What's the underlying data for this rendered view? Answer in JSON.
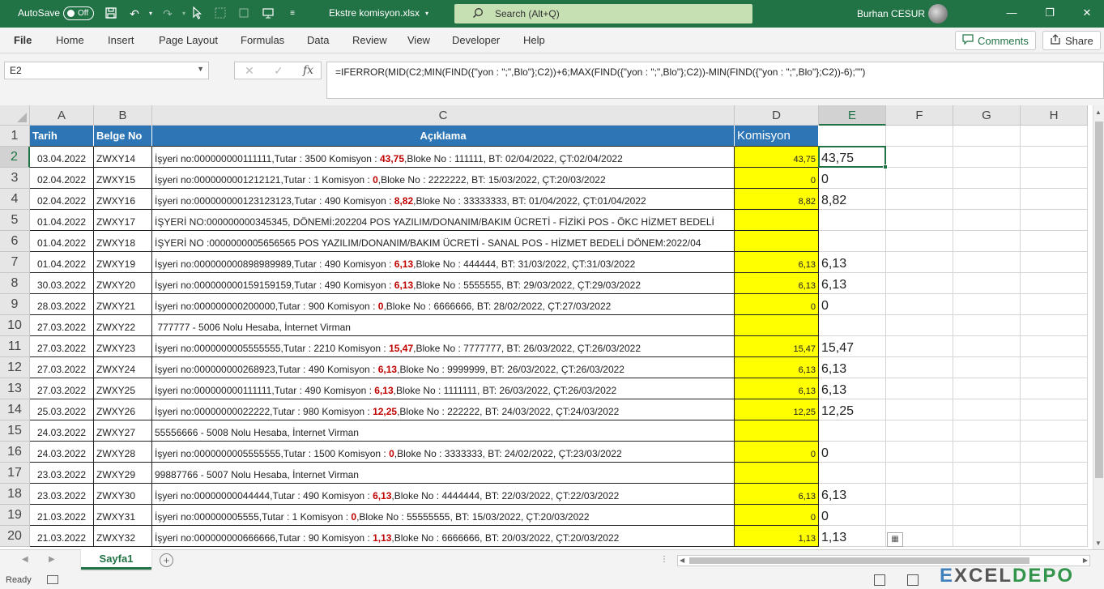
{
  "titlebar": {
    "autosave_label": "AutoSave",
    "autosave_state": "Off",
    "filename": "Ekstre komisyon.xlsx",
    "search_placeholder": "Search (Alt+Q)",
    "user": "Burhan CESUR",
    "accent_color": "#217346"
  },
  "ribbon": {
    "tabs": [
      "File",
      "Home",
      "Insert",
      "Page Layout",
      "Formulas",
      "Data",
      "Review",
      "View",
      "Developer",
      "Help"
    ],
    "comments_label": "Comments",
    "share_label": "Share"
  },
  "formula_bar": {
    "name_box": "E2",
    "fx": "fx",
    "formula": "=IFERROR(MID(C2;MIN(FIND({\"yon : \";\",Blo\"};C2))+6;MAX(FIND({\"yon : \";\",Blo\"};C2))-MIN(FIND({\"yon : \";\",Blo\"};C2))-6);\"\")"
  },
  "columns": [
    "A",
    "B",
    "C",
    "D",
    "E",
    "F",
    "G",
    "H"
  ],
  "header_row": {
    "tarih": "Tarih",
    "belge": "Belge No",
    "aciklama": "Açıklama",
    "komisyon": "Komisyon"
  },
  "rows": [
    {
      "n": "1"
    },
    {
      "n": "2",
      "a": "03.04.2022",
      "b": "ZWXY14",
      "c1": "İşyeri no:000000000111111,Tutar : 3500 Komisyon : ",
      "cr": "43,75",
      "c2": ",Bloke No : 111111, BT: 02/04/2022, ÇT:02/04/2022",
      "d": "43,75",
      "e": "43,75"
    },
    {
      "n": "3",
      "a": "02.04.2022",
      "b": "ZWXY15",
      "c1": "İşyeri no:0000000001212121,Tutar : 1 Komisyon : ",
      "cr": "0",
      "c2": ",Bloke No : 2222222, BT: 15/03/2022, ÇT:20/03/2022",
      "d": "0",
      "e": "0"
    },
    {
      "n": "4",
      "a": "02.04.2022",
      "b": "ZWXY16",
      "c1": "İşyeri no:000000000123123123,Tutar : 490 Komisyon : ",
      "cr": "8,82",
      "c2": ",Bloke No : 33333333, BT: 01/04/2022, ÇT:01/04/2022",
      "d": "8,82",
      "e": "8,82"
    },
    {
      "n": "5",
      "a": "01.04.2022",
      "b": "ZWXY17",
      "c1": "İŞYERİ NO:000000000345345, DÖNEMİ:202204 POS YAZILIM/DONANIM/BAKIM ÜCRETİ - FİZİKİ POS - ÖKC HİZMET BEDELİ",
      "cr": "",
      "c2": "",
      "d": "",
      "e": ""
    },
    {
      "n": "6",
      "a": "01.04.2022",
      "b": "ZWXY18",
      "c1": "İŞYERİ NO :0000000005656565 POS YAZILIM/DONANIM/BAKIM ÜCRETİ - SANAL POS - HİZMET BEDELİ DÖNEM:2022/04",
      "cr": "",
      "c2": "",
      "d": "",
      "e": ""
    },
    {
      "n": "7",
      "a": "01.04.2022",
      "b": "ZWXY19",
      "c1": "İşyeri no:000000000898989989,Tutar : 490 Komisyon : ",
      "cr": "6,13",
      "c2": ",Bloke No : 444444, BT: 31/03/2022, ÇT:31/03/2022",
      "d": "6,13",
      "e": "6,13"
    },
    {
      "n": "8",
      "a": "30.03.2022",
      "b": "ZWXY20",
      "c1": "İşyeri no:000000000159159159,Tutar : 490 Komisyon : ",
      "cr": "6,13",
      "c2": ",Bloke No : 5555555, BT: 29/03/2022, ÇT:29/03/2022",
      "d": "6,13",
      "e": "6,13"
    },
    {
      "n": "9",
      "a": "28.03.2022",
      "b": "ZWXY21",
      "c1": "İşyeri no:000000000200000,Tutar : 900 Komisyon : ",
      "cr": "0",
      "c2": ",Bloke No : 6666666, BT: 28/02/2022, ÇT:27/03/2022",
      "d": "0",
      "e": "0"
    },
    {
      "n": "10",
      "a": "27.03.2022",
      "b": "ZWXY22",
      "c1": " 777777 - 5006 Nolu Hesaba, İnternet Virman",
      "cr": "",
      "c2": "",
      "d": "",
      "e": ""
    },
    {
      "n": "11",
      "a": "27.03.2022",
      "b": "ZWXY23",
      "c1": "İşyeri no:0000000005555555,Tutar : 2210 Komisyon : ",
      "cr": "15,47",
      "c2": ",Bloke No : 7777777, BT: 26/03/2022, ÇT:26/03/2022",
      "d": "15,47",
      "e": "15,47"
    },
    {
      "n": "12",
      "a": "27.03.2022",
      "b": "ZWXY24",
      "c1": "İşyeri no:000000000268923,Tutar : 490 Komisyon : ",
      "cr": "6,13",
      "c2": ",Bloke No : 9999999, BT: 26/03/2022, ÇT:26/03/2022",
      "d": "6,13",
      "e": "6,13"
    },
    {
      "n": "13",
      "a": "27.03.2022",
      "b": "ZWXY25",
      "c1": "İşyeri no:000000000111111,Tutar : 490 Komisyon : ",
      "cr": "6,13",
      "c2": ",Bloke No : 1111111, BT: 26/03/2022, ÇT:26/03/2022",
      "d": "6,13",
      "e": "6,13"
    },
    {
      "n": "14",
      "a": "25.03.2022",
      "b": "ZWXY26",
      "c1": "İşyeri no:00000000022222,Tutar : 980 Komisyon : ",
      "cr": "12,25",
      "c2": ",Bloke No : 222222, BT: 24/03/2022, ÇT:24/03/2022",
      "d": "12,25",
      "e": "12,25"
    },
    {
      "n": "15",
      "a": "24.03.2022",
      "b": "ZWXY27",
      "c1": "55556666 - 5008 Nolu Hesaba, İnternet Virman",
      "cr": "",
      "c2": "",
      "d": "",
      "e": ""
    },
    {
      "n": "16",
      "a": "24.03.2022",
      "b": "ZWXY28",
      "c1": "İşyeri no:0000000005555555,Tutar : 1500 Komisyon : ",
      "cr": "0",
      "c2": ",Bloke No : 3333333, BT: 24/02/2022, ÇT:23/03/2022",
      "d": "0",
      "e": "0"
    },
    {
      "n": "17",
      "a": "23.03.2022",
      "b": "ZWXY29",
      "c1": "99887766 - 5007 Nolu Hesaba, İnternet Virman",
      "cr": "",
      "c2": "",
      "d": "",
      "e": ""
    },
    {
      "n": "18",
      "a": "23.03.2022",
      "b": "ZWXY30",
      "c1": "İşyeri no:00000000044444,Tutar : 490 Komisyon : ",
      "cr": "6,13",
      "c2": ",Bloke No : 4444444, BT: 22/03/2022, ÇT:22/03/2022",
      "d": "6,13",
      "e": "6,13"
    },
    {
      "n": "19",
      "a": "21.03.2022",
      "b": "ZWXY31",
      "c1": "İşyeri no:000000005555,Tutar : 1 Komisyon : ",
      "cr": "0",
      "c2": ",Bloke No : 55555555, BT: 15/03/2022, ÇT:20/03/2022",
      "d": "0",
      "e": "0"
    },
    {
      "n": "20",
      "a": "21.03.2022",
      "b": "ZWXY32",
      "c1": "İşyeri no:000000000666666,Tutar : 90 Komisyon : ",
      "cr": "1,13",
      "c2": ",Bloke No : 6666666, BT: 20/03/2022, ÇT:20/03/2022",
      "d": "1,13",
      "e": "1,13"
    }
  ],
  "sheets": {
    "active": "Sayfa1"
  },
  "status": {
    "ready": "Ready"
  },
  "watermark": {
    "a": "E",
    "b": "XCEL",
    "c": "DEPO"
  }
}
